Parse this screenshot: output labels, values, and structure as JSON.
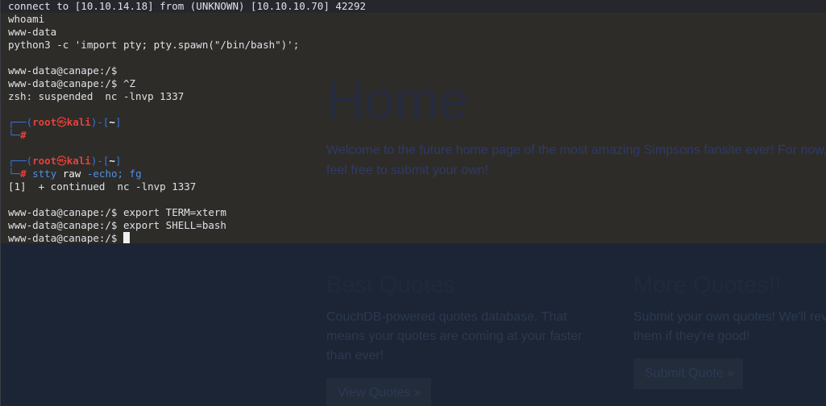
{
  "website": {
    "hero": {
      "title": "Home",
      "text": "Welcome to the future home page of the most amazing Simpsons fansite ever! For now, feel free to submit your own!"
    },
    "columns": [
      {
        "heading": "Best Quotes",
        "text": "CouchDB-powered quotes database. That means your quotes are coming at your faster than ever!",
        "button": "View Quotes »"
      },
      {
        "heading": "More Quotes!!",
        "text": "Submit your own quotes! We'll review and them if they're good!",
        "button": "Submit Quote »"
      }
    ]
  },
  "terminal": {
    "connect_line": "connect to [10.10.14.18] from (UNKNOWN) [10.10.10.70] 42292",
    "lines": {
      "whoami": "whoami",
      "www_data": "www-data",
      "spawn": "python3 -c 'import pty; pty.spawn(\"/bin/bash\")';",
      "prompt1": "www-data@canape:/$ ",
      "prompt2": "www-data@canape:/$ ^Z",
      "suspended": "zsh: suspended  nc -lnvp 1337",
      "continued": "[1]  + continued  nc -lnvp 1337",
      "export_term": "www-data@canape:/$ export TERM=xterm",
      "export_shell": "www-data@canape:/$ export SHELL=bash",
      "prompt_final": "www-data@canape:/$ "
    },
    "kali_prompt": {
      "box_top_left": "┌──(",
      "user": "root",
      "skull": "㉿",
      "host": "kali",
      "sep": ")-[",
      "cwd": "~",
      "close": "]",
      "box_bottom": "└─",
      "hash": "#"
    },
    "stty": {
      "cmd": "stty",
      "arg1": " raw",
      "arg2": " -echo;",
      "arg3": " fg"
    }
  }
}
